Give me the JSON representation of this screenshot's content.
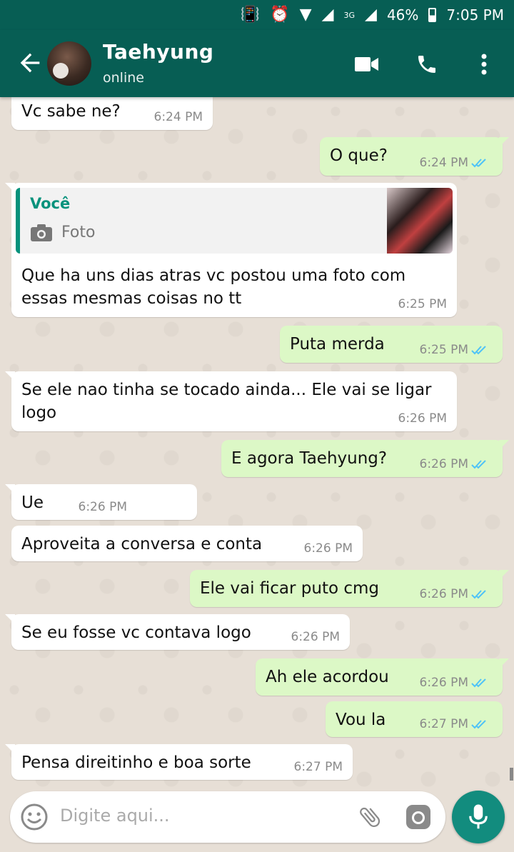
{
  "status_bar": {
    "battery": "46%",
    "time": "7:05 PM",
    "network": "3G"
  },
  "header": {
    "name": "Taehyung",
    "status": "online"
  },
  "messages": [
    {
      "dir": "in",
      "text": "Vc sabe ne?",
      "time": "6:24 PM"
    },
    {
      "dir": "out",
      "text": "O que?",
      "time": "6:24 PM"
    },
    {
      "dir": "in",
      "text": "Que ha uns dias atras vc postou uma foto com\nessas mesmas coisas no tt",
      "time": "6:25 PM",
      "quote": {
        "author": "Você",
        "type": "Foto"
      }
    },
    {
      "dir": "out",
      "text": "Puta merda",
      "time": "6:25 PM"
    },
    {
      "dir": "in",
      "text": "Se ele nao tinha se tocado ainda... Ele vai se ligar\nlogo",
      "time": "6:26 PM"
    },
    {
      "dir": "out",
      "text": "E agora Taehyung?",
      "time": "6:26 PM"
    },
    {
      "dir": "in",
      "text": "Ue",
      "time": "6:26 PM"
    },
    {
      "dir": "in",
      "text": "Aproveita a conversa e conta",
      "time": "6:26 PM"
    },
    {
      "dir": "out",
      "text": "Ele vai ficar puto cmg",
      "time": "6:26 PM"
    },
    {
      "dir": "in",
      "text": "Se eu fosse vc contava logo",
      "time": "6:26 PM"
    },
    {
      "dir": "out",
      "text": "Ah ele acordou",
      "time": "6:26 PM"
    },
    {
      "dir": "out",
      "text": "Vou la",
      "time": "6:27 PM"
    },
    {
      "dir": "in",
      "text": "Pensa direitinho e boa sorte",
      "time": "6:27 PM"
    }
  ],
  "input": {
    "placeholder": "Digite aqui..."
  },
  "colors": {
    "header": "#075e54",
    "incoming": "#ffffff",
    "outgoing": "#dcf8c6",
    "accent": "#128c7e",
    "ticks": "#4fc3f7"
  }
}
